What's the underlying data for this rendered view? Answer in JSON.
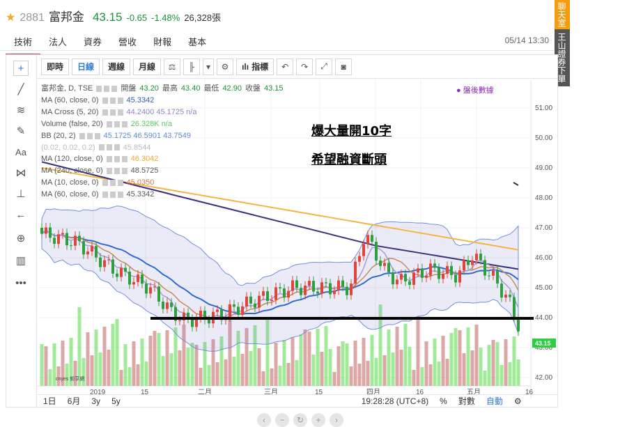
{
  "header": {
    "code": "2881",
    "name": "富邦金",
    "price": "43.15",
    "change": "-0.65",
    "percent": "-1.48%",
    "volume": "26,328張"
  },
  "nav": {
    "tabs": [
      "技術",
      "法人",
      "資券",
      "營收",
      "財報",
      "基本"
    ],
    "timestamp": "05/14 13:30"
  },
  "side_buttons": [
    "聊天室",
    "王山證券下單"
  ],
  "toolbar": {
    "intervals": [
      "即時",
      "日線",
      "週線",
      "月線"
    ],
    "indicator_label": "指標"
  },
  "legend": {
    "symbol_line": {
      "symbol": "富邦金, D, TSE",
      "open_label": "開盤",
      "open": "43.20",
      "high_label": "最高",
      "high": "43.40",
      "low_label": "最低",
      "low": "42.90",
      "close_label": "收盤",
      "close": "43.15"
    },
    "rows": [
      {
        "label": "MA (60, close, 0)",
        "value": "45.3342",
        "color": "#2e5fa8"
      },
      {
        "label": "MA Cross (5, 20)",
        "value": "44.2400  45.1725  n/a",
        "color": "#8e84c4"
      },
      {
        "label": "Volume (false, 20)",
        "value": "26.328K  n/a",
        "color": "#5ac95a"
      },
      {
        "label": "BB (20, 2)",
        "value": "45.1725  46.5901  43.7549",
        "color": "#5b8ad1"
      },
      {
        "label": "(0.02, 0.02, 0.2)",
        "value": "45.8544",
        "color": "#aaa"
      },
      {
        "label": "MA (120, close, 0)",
        "value": "46.3042",
        "color": "#f0a830"
      },
      {
        "label": "MA (240, close, 0)",
        "value": "48.5725",
        "color": "#555"
      },
      {
        "label": "MA (10, close, 0)",
        "value": "45.0350",
        "color": "#c97c4a"
      },
      {
        "label": "MA (60, close, 0)",
        "value": "45.3342",
        "color": "#555"
      }
    ]
  },
  "after_hours_label": "盤後數據",
  "annotations": [
    "爆大量開10字",
    "希望融資斷頭"
  ],
  "price_axis": {
    "ticks": [
      "51.00",
      "50.00",
      "49.00",
      "48.00",
      "47.00",
      "46.00",
      "45.00",
      "44.00",
      "43.00",
      "42.00"
    ],
    "current_tag": "43.15"
  },
  "time_axis": {
    "labels": [
      "2019",
      "15",
      "二月",
      "三月",
      "15",
      "四月",
      "16",
      "五月",
      "16"
    ]
  },
  "bottom_bar": {
    "ranges": [
      "1日",
      "6月",
      "3y",
      "5y"
    ],
    "clock": "19:28:28 (UTC+8)",
    "percent": "%",
    "log": "對數",
    "auto": "自動"
  },
  "watermark": "cnyes 鉅亨網"
}
